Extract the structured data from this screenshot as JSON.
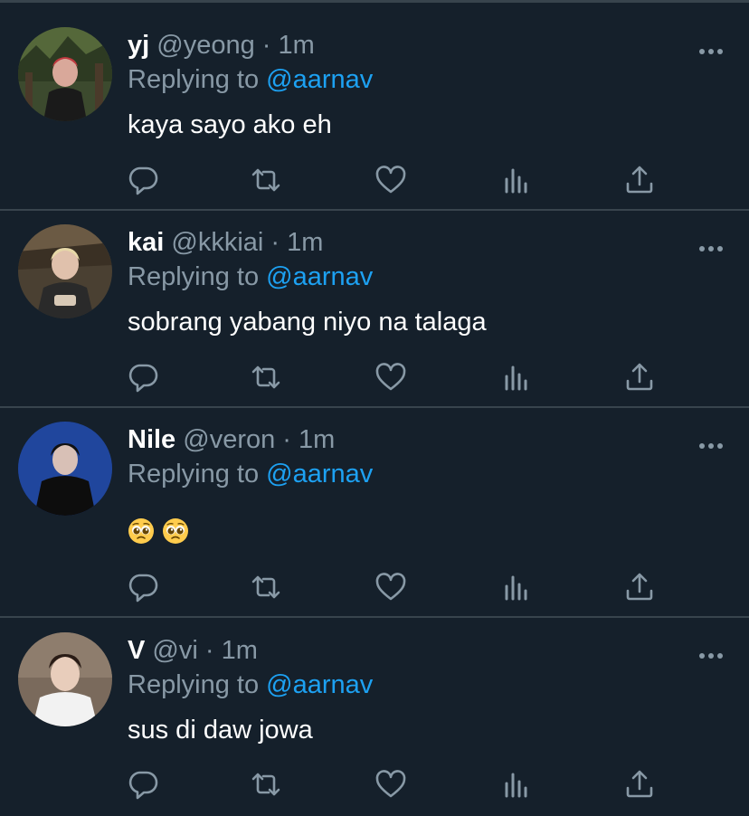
{
  "colors": {
    "background": "#15202b",
    "divider": "#38444d",
    "muted": "#8899a6",
    "mention": "#1da1f2",
    "text": "#ffffff"
  },
  "tweets": [
    {
      "name": "yj",
      "handle": "@yeong",
      "separator": "·",
      "time": "1m",
      "replying_prefix": "Replying to",
      "replying_to": "@aarnav",
      "text": "kaya sayo ako eh",
      "avatar": "avatar-photo"
    },
    {
      "name": "kai",
      "handle": "@kkkiai",
      "separator": "·",
      "time": "1m",
      "replying_prefix": "Replying to",
      "replying_to": "@aarnav",
      "text": "sobrang yabang niyo na talaga",
      "avatar": "avatar-photo"
    },
    {
      "name": "Nile",
      "handle": "@veron",
      "separator": "·",
      "time": "1m",
      "replying_prefix": "Replying to",
      "replying_to": "@aarnav",
      "text": "🥺 🥺",
      "avatar": "avatar-photo"
    },
    {
      "name": "V",
      "handle": "@vi",
      "separator": "·",
      "time": "1m",
      "replying_prefix": "Replying to",
      "replying_to": "@aarnav",
      "text": "sus di daw jowa",
      "avatar": "avatar-photo"
    }
  ],
  "action_icons": [
    "reply-icon",
    "retweet-icon",
    "like-icon",
    "analytics-icon",
    "share-icon"
  ]
}
